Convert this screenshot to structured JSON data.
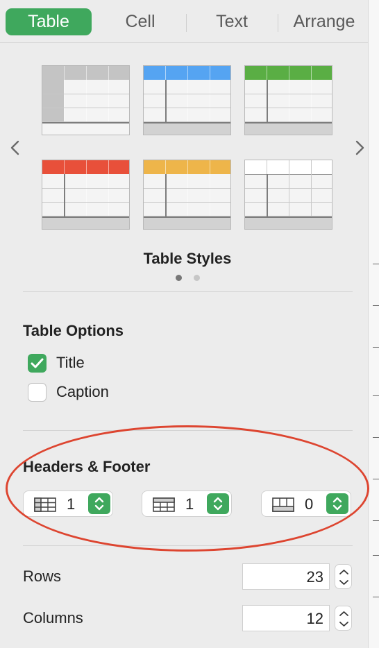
{
  "tabs": [
    {
      "label": "Table",
      "active": true
    },
    {
      "label": "Cell",
      "active": false
    },
    {
      "label": "Text",
      "active": false
    },
    {
      "label": "Arrange",
      "active": false
    }
  ],
  "table_styles": {
    "title": "Table Styles",
    "page_count": 2,
    "current_page": 1,
    "swatches": [
      {
        "name": "gray",
        "header_color": "#c4c4c4"
      },
      {
        "name": "blue",
        "header_color": "#55a4f2"
      },
      {
        "name": "green",
        "header_color": "#5aae44"
      },
      {
        "name": "red",
        "header_color": "#e8503a"
      },
      {
        "name": "orange",
        "header_color": "#eeb54a"
      },
      {
        "name": "plain",
        "header_color": "#ffffff"
      }
    ]
  },
  "table_options": {
    "title": "Table Options",
    "title_checkbox": {
      "label": "Title",
      "checked": true
    },
    "caption_checkbox": {
      "label": "Caption",
      "checked": false
    }
  },
  "headers_footer": {
    "title": "Headers & Footer",
    "header_rows": "1",
    "header_columns": "1",
    "footer_rows": "0"
  },
  "rows": {
    "label": "Rows",
    "value": "23"
  },
  "columns": {
    "label": "Columns",
    "value": "12"
  },
  "colors": {
    "accent": "#3fa85d",
    "annotation": "#dd4530"
  },
  "annotation": "red-oval-around-headers-footer"
}
